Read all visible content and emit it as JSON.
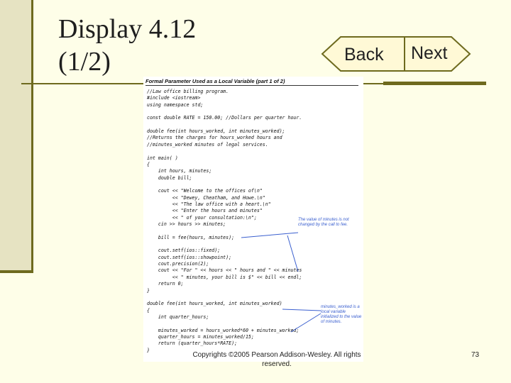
{
  "slide": {
    "title_line1": "Display 4.12",
    "title_line2": "(1/2)",
    "back_label": "Back",
    "next_label": "Next",
    "copyright": "Copyrights ©2005 Pearson Addison-Wesley. All rights reserved.",
    "page_number": "73"
  },
  "code": {
    "heading": "Formal Parameter Used as a Local Variable (part 1 of 2)",
    "lines": [
      "//Law office billing program.",
      "#include <iostream>",
      "using namespace std;",
      "",
      "const double RATE = 150.00; //Dollars per quarter hour.",
      "",
      "double fee(int hours_worked, int minutes_worked);",
      "//Returns the charges for hours_worked hours and",
      "//minutes_worked minutes of legal services.",
      "",
      "int main( )",
      "{",
      "    int hours, minutes;",
      "    double bill;",
      "",
      "    cout << \"Welcome to the offices of\\n\"",
      "         << \"Dewey, Cheatham, and Howe.\\n\"",
      "         << \"The law office with a heart.\\n\"",
      "         << \"Enter the hours and minutes\"",
      "         << \" of your consultation:\\n\";",
      "    cin >> hours >> minutes;",
      "",
      "    bill = fee(hours, minutes);",
      "",
      "    cout.setf(ios::fixed);",
      "    cout.setf(ios::showpoint);",
      "    cout.precision(2);",
      "    cout << \"For \" << hours << \" hours and \" << minutes",
      "         << \" minutes, your bill is $\" << bill << endl;",
      "    return 0;",
      "}",
      "",
      "double fee(int hours_worked, int minutes_worked)",
      "{",
      "    int quarter_hours;",
      "",
      "    minutes_worked = hours_worked*60 + minutes_worked;",
      "    quarter_hours = minutes_worked/15;",
      "    return (quarter_hours*RATE);",
      "}"
    ],
    "note_minutes": "The value of minutes is not changed by the call to fee.",
    "note_minutes_worked": "minutes_worked is a local variable initialized to the value of minutes."
  },
  "colors": {
    "background": "#fefee8",
    "accent": "#6e6a1e",
    "highlight": "#3a5fcf",
    "button_fill": "#fff9d6"
  }
}
